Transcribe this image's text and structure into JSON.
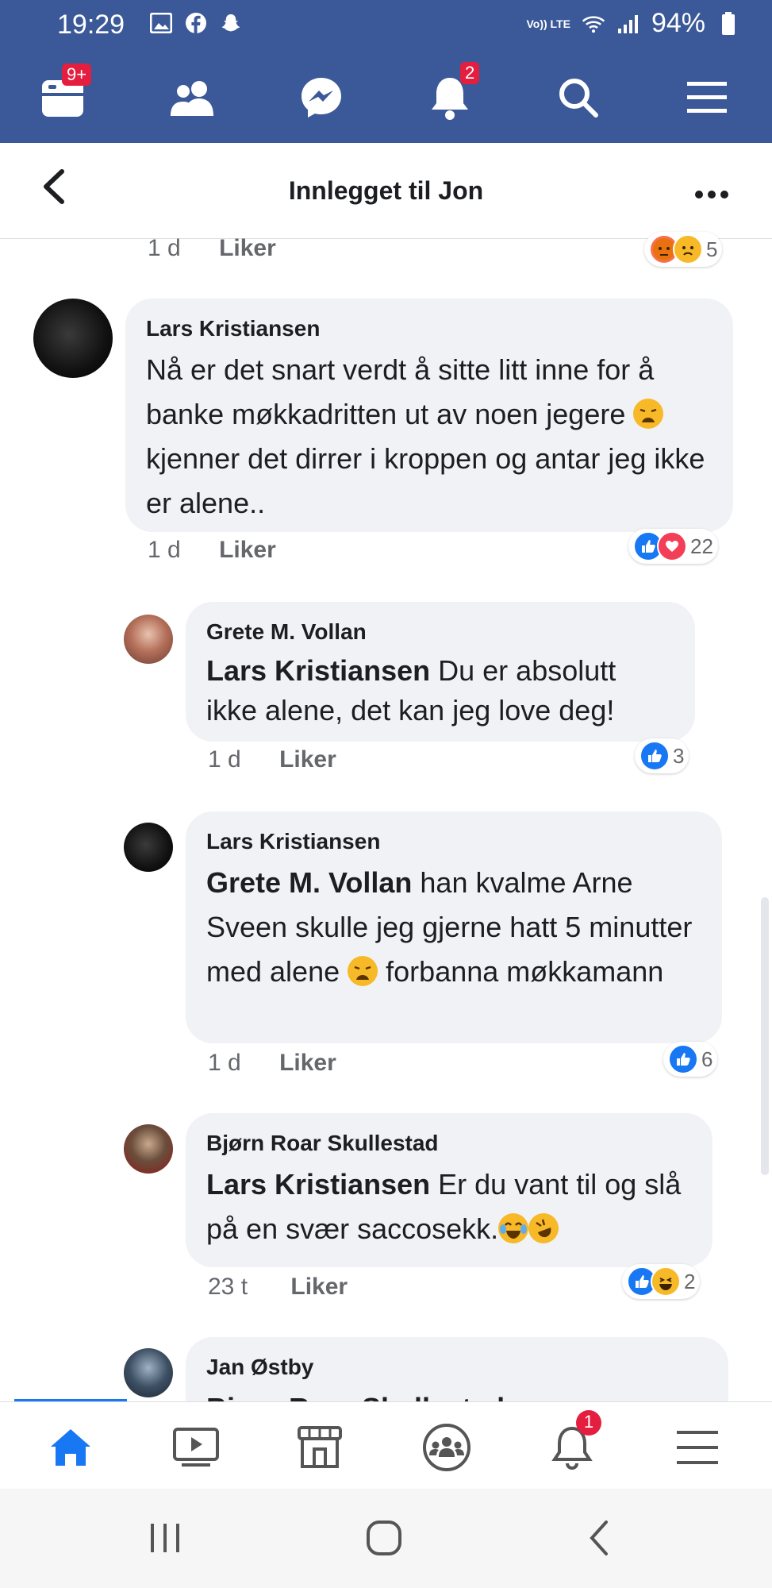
{
  "status_bar": {
    "time": "19:29",
    "icons": [
      "gallery-icon",
      "facebook-icon",
      "snapchat-icon"
    ],
    "network": "Vo)) LTE",
    "battery": "94%"
  },
  "fb_nav": {
    "feed_badge": "9+",
    "notifications_badge": "2"
  },
  "header": {
    "title": "Innlegget til Jon"
  },
  "comments": [
    {
      "time": "1 d",
      "like": "Liker",
      "reaction_count": "5"
    },
    {
      "author": "Lars Kristiansen",
      "text_before": "Nå er det snart verdt å sitte litt inne for å banke møkkadritten ut av noen jegere",
      "text_after": "kjenner det dirrer i kroppen og antar jeg ikke er alene..",
      "time": "1 d",
      "like": "Liker",
      "reaction_count": "22"
    },
    {
      "author": "Grete M. Vollan",
      "mention": "Lars Kristiansen",
      "text": "Du er absolutt ikke alene, det kan jeg love deg!",
      "time": "1 d",
      "like": "Liker",
      "reaction_count": "3"
    },
    {
      "author": "Lars Kristiansen",
      "mention": "Grete M. Vollan",
      "text_before": "han kvalme Arne Sveen skulle jeg gjerne hatt 5 minutter med alene",
      "text_after": "forbanna møkkamann",
      "time": "1 d",
      "like": "Liker",
      "reaction_count": "6"
    },
    {
      "author": "Bjørn Roar Skullestad",
      "mention": "Lars Kristiansen",
      "text": "Er du vant til og slå på en svær saccosekk.",
      "time": "23 t",
      "like": "Liker",
      "reaction_count": "2"
    },
    {
      "author": "Jan Østby",
      "partial_text": "Bjørn Roar Skullestad"
    }
  ],
  "bottom_nav": {
    "notifications_badge": "1"
  },
  "colors": {
    "facebook_blue": "#3b5998",
    "active_blue": "#1877f2",
    "badge_red": "#e41e3f",
    "bubble_gray": "#f0f2f5"
  }
}
